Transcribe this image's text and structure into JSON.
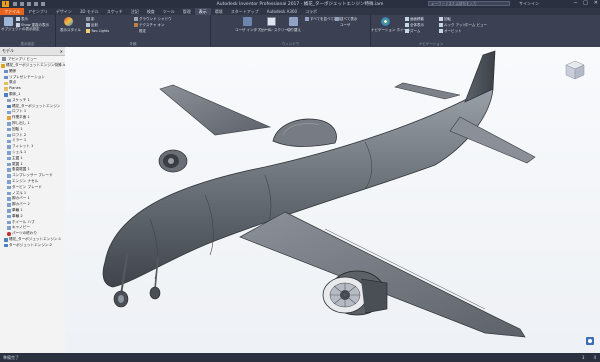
{
  "app": {
    "icon_label": "I",
    "title": "Autodesk Inventor Professional 2017 - 橘花_ターボジェットエンジン特殊.iam",
    "search_placeholder": "キーワードまたは語句を入力",
    "signin": "サインイン",
    "window_controls": [
      "─",
      "□",
      "✕"
    ]
  },
  "tabs": [
    "ファイル",
    "アセンブリ",
    "デザイン",
    "3D モデル",
    "スケッチ",
    "注記",
    "検査",
    "ツール",
    "管理",
    "表示",
    "環境",
    "スタートアップ",
    "Autodesk A360",
    "コラボ"
  ],
  "active_tab": "表示",
  "ribbon": {
    "visibility": {
      "label": "表示設定",
      "items": [
        "オブジェクトの表示設定",
        "表示",
        "Show 重複の表示"
      ]
    },
    "appearance": {
      "label": "外観",
      "items": [
        "表示スタイル",
        "影",
        "反射",
        "Two Lights",
        "グラウンド シャドウ",
        "テクスチャ オン",
        "既定"
      ]
    },
    "windows": {
      "label": "ウィンドウ",
      "items": [
        "ユーザ インタフェース",
        "クリーン スクリーン",
        "切り替え",
        "すべてを並べて表示",
        "並べて表示",
        "ユーザ"
      ]
    },
    "navigate": {
      "label": "ナビゲーション",
      "items": [
        "ナビゲーション ホイール",
        "画面移動",
        "全体表示",
        "ズーム",
        "回転",
        "ルック アット",
        "オービット",
        "ホーム ビュー"
      ]
    }
  },
  "browser": {
    "title": "モデル",
    "toolbar": [
      "アセンブリ ビュー"
    ],
    "items": [
      {
        "label": "橘花_ターボジェットエンジン特殊.iam",
        "indent": 0,
        "icon": "assembly",
        "color": "#e0a020"
      },
      {
        "label": "関係",
        "indent": 1,
        "icon": "folder",
        "color": "#6b8fc7"
      },
      {
        "label": "リプレゼンテーション",
        "indent": 1,
        "icon": "folder",
        "color": "#6b8fc7"
      },
      {
        "label": "原点",
        "indent": 1,
        "icon": "folder",
        "color": "#e0c060"
      },
      {
        "label": "Planes",
        "indent": 1,
        "icon": "folder",
        "color": "#e0c060"
      },
      {
        "label": "胴体_1",
        "indent": 1,
        "icon": "part",
        "color": "#4a7fc0"
      },
      {
        "label": "スケッチ 1",
        "indent": 2,
        "icon": "sketch",
        "color": "#8aa0c0"
      },
      {
        "label": "橘花_ターボジェットエンジン",
        "indent": 2,
        "icon": "part",
        "color": "#4a7fc0"
      },
      {
        "label": "ロフト 1",
        "indent": 2,
        "icon": "feature",
        "color": "#7f9fcf"
      },
      {
        "label": "作業平面 1",
        "indent": 2,
        "icon": "plane",
        "color": "#e0a040"
      },
      {
        "label": "押し出し 1",
        "indent": 2,
        "icon": "feature",
        "color": "#7f9fcf"
      },
      {
        "label": "回転 1",
        "indent": 2,
        "icon": "feature",
        "color": "#7f9fcf"
      },
      {
        "label": "ロフト 2",
        "indent": 2,
        "icon": "feature",
        "color": "#7f9fcf"
      },
      {
        "label": "ミラー 1",
        "indent": 2,
        "icon": "feature",
        "color": "#7f9fcf"
      },
      {
        "label": "フィレット 1",
        "indent": 2,
        "icon": "feature",
        "color": "#7f9fcf"
      },
      {
        "label": "シェル 1",
        "indent": 2,
        "icon": "feature",
        "color": "#7f9fcf"
      },
      {
        "label": "主翼 1",
        "indent": 2,
        "icon": "feature",
        "color": "#7f9fcf"
      },
      {
        "label": "尾翼 1",
        "indent": 2,
        "icon": "feature",
        "color": "#7f9fcf"
      },
      {
        "label": "垂直尾翼 1",
        "indent": 2,
        "icon": "feature",
        "color": "#7f9fcf"
      },
      {
        "label": "コンプレッサー ブレード",
        "indent": 2,
        "icon": "feature",
        "color": "#7f9fcf"
      },
      {
        "label": "エンジン ナセル",
        "indent": 2,
        "icon": "feature",
        "color": "#7f9fcf"
      },
      {
        "label": "タービン ブレード",
        "indent": 2,
        "icon": "feature",
        "color": "#7f9fcf"
      },
      {
        "label": "ノズル 1",
        "indent": 2,
        "icon": "feature",
        "color": "#7f9fcf"
      },
      {
        "label": "脚カバー 1",
        "indent": 2,
        "icon": "feature",
        "color": "#7f9fcf"
      },
      {
        "label": "脚カバー 2",
        "indent": 2,
        "icon": "feature",
        "color": "#7f9fcf"
      },
      {
        "label": "車輪 1",
        "indent": 2,
        "icon": "feature",
        "color": "#7f9fcf"
      },
      {
        "label": "車輪 2",
        "indent": 2,
        "icon": "feature",
        "color": "#7f9fcf"
      },
      {
        "label": "ホイール ハブ",
        "indent": 2,
        "icon": "feature",
        "color": "#7f9fcf"
      },
      {
        "label": "キャノピー",
        "indent": 2,
        "icon": "feature",
        "color": "#7f9fcf"
      },
      {
        "label": "パーツの終わり",
        "indent": 2,
        "icon": "end",
        "color": "#c03030"
      },
      {
        "label": "橘花_ターボジェットエンジン:1",
        "indent": 1,
        "icon": "part",
        "color": "#4a7fc0"
      },
      {
        "label": "ターボジェットエンジン:2",
        "indent": 1,
        "icon": "part",
        "color": "#4a7fc0"
      }
    ]
  },
  "status": {
    "text": "準備完了",
    "right": [
      "3",
      "4"
    ]
  }
}
